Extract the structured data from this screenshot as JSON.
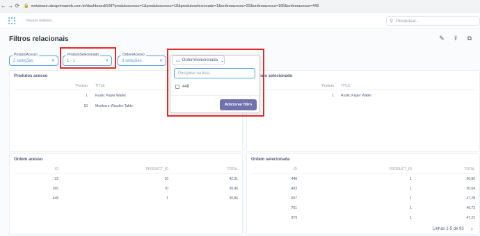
{
  "browser": {
    "back": "←",
    "forward": "→",
    "reload": "⟳",
    "url": "metabase.obraprimaweb.com.br/dashboard/168?produtoacesso=1&produtoacesso=10&produtoselecionado=1&ordemacesso=22&ordemacesso=165&ordemacesso=448"
  },
  "header": {
    "breadcrumb": "Nossas análises",
    "search_placeholder": "Pesquisar..."
  },
  "dashboard": {
    "title": "Filtros relacionais"
  },
  "filters": [
    {
      "label": "ProdutoAcesso",
      "value": "2 seleções"
    },
    {
      "label": "ProdutoSelecionado",
      "value": "1 - 1"
    },
    {
      "label": "OrdemAcesso",
      "value": "3 seleções"
    }
  ],
  "popover": {
    "chip_label": "OrdemSelecionada",
    "search_placeholder": "Pesquise na lista",
    "option": "448",
    "add_button": "Adicionar filtro"
  },
  "cards": {
    "produtos_acesso": {
      "title": "Produtos acesso",
      "columns": [
        "Produto",
        "TITLE"
      ],
      "rows": [
        [
          "1",
          "Rustic Paper Wallet"
        ],
        [
          "10",
          "Mediocre Wooden Table"
        ]
      ]
    },
    "produto_selecionado": {
      "title": "Produto selecionado",
      "columns": [
        "Produto",
        "TITLE"
      ],
      "rows": [
        [
          "1",
          "Rustic Paper Wallet"
        ]
      ]
    },
    "ordem_acesso": {
      "title": "Ordem acesso",
      "columns": [
        "ID",
        "PRODUCT_ID",
        "TOTAL"
      ],
      "rows": [
        [
          "22",
          "10",
          "42,31"
        ],
        [
          "165",
          "10",
          "30,96"
        ],
        [
          "448",
          "1",
          "30,86"
        ]
      ]
    },
    "ordem_selecionada": {
      "title": "Ordem selecionada",
      "columns": [
        "ID",
        "PRODUCT_ID",
        "TOTAL"
      ],
      "rows": [
        [
          "448",
          "1",
          "30,86"
        ],
        [
          "493",
          "1",
          "30,64"
        ],
        [
          "607",
          "1",
          "47,28"
        ],
        [
          "761",
          "1",
          "46,73"
        ],
        [
          "979",
          "1",
          "47,23"
        ]
      ],
      "pager": "Linhas 1-5 de 93"
    }
  },
  "colors": {
    "accent": "#509ee3",
    "button": "#7172ad",
    "highlight": "#e02a2a"
  },
  "icons": [
    "back-icon",
    "forward-icon",
    "reload-icon",
    "lock-icon",
    "search-icon",
    "pencil-icon",
    "share-icon",
    "clone-icon",
    "info-icon",
    "close-icon",
    "calendar-icon",
    "chevron-down-icon",
    "chevron-right-icon"
  ]
}
